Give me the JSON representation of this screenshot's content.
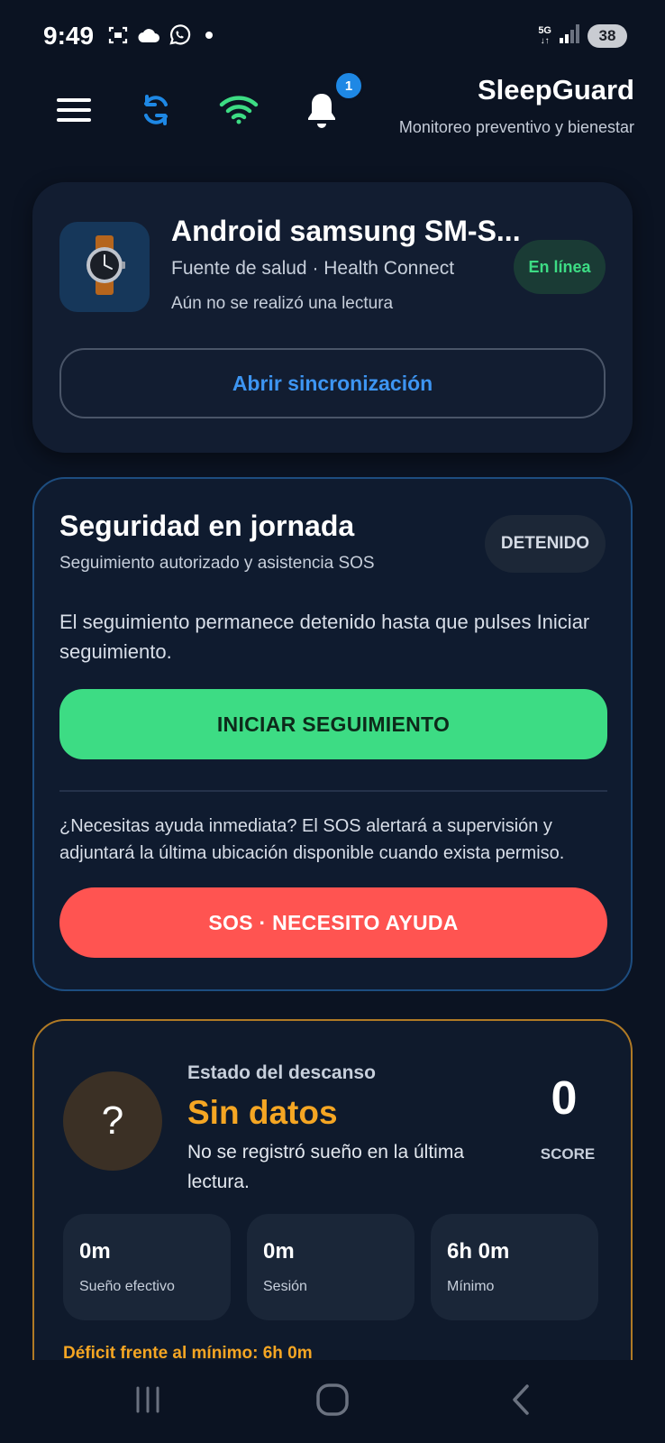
{
  "status_bar": {
    "time": "9:49",
    "network": "5G",
    "battery": "38",
    "icons": [
      "screenshot-icon",
      "cloud-icon",
      "whatsapp-icon",
      "dot-icon",
      "signal-icon"
    ]
  },
  "header": {
    "title": "SleepGuard",
    "subtitle": "Monitoreo preventivo y bienestar",
    "notification_count": "1",
    "icons": [
      "menu-icon",
      "sync-icon",
      "wifi-icon",
      "bell-icon"
    ],
    "colors": {
      "sync": "#1e88e5",
      "wifi": "#3ddc84"
    }
  },
  "device_card": {
    "name": "Android samsung SM-S...",
    "source": "Fuente de salud · Health Connect",
    "last_reading": "Aún no se realizó una lectura",
    "status": "En línea",
    "sync_button": "Abrir sincronización",
    "icon": "smartwatch-icon"
  },
  "safety_card": {
    "title": "Seguridad en jornada",
    "subtitle": "Seguimiento autorizado y asistencia SOS",
    "status": "DETENIDO",
    "description": "El seguimiento permanece detenido hasta que pulses Iniciar seguimiento.",
    "start_button": "INICIAR SEGUIMIENTO",
    "help_text": "¿Necesitas ayuda inmediata? El SOS alertará a supervisión y adjuntará la última ubicación disponible cuando exista permiso.",
    "sos_button": "SOS · NECESITO AYUDA",
    "colors": {
      "start": "#3ddc84",
      "sos": "#ff5451"
    }
  },
  "rest_card": {
    "symbol": "?",
    "label": "Estado del descanso",
    "status": "Sin datos",
    "description": "No se registró sueño en la última lectura.",
    "score": "0",
    "score_label": "SCORE",
    "stats": [
      {
        "value": "0m",
        "label": "Sueño efectivo"
      },
      {
        "value": "0m",
        "label": "Sesión"
      },
      {
        "value": "6h 0m",
        "label": "Mínimo"
      }
    ],
    "deficit": "Déficit frente al mínimo: 6h 0m",
    "accent": "#f5a623"
  },
  "nav_bar": {
    "icons": [
      "recents-icon",
      "home-icon",
      "back-icon"
    ]
  }
}
